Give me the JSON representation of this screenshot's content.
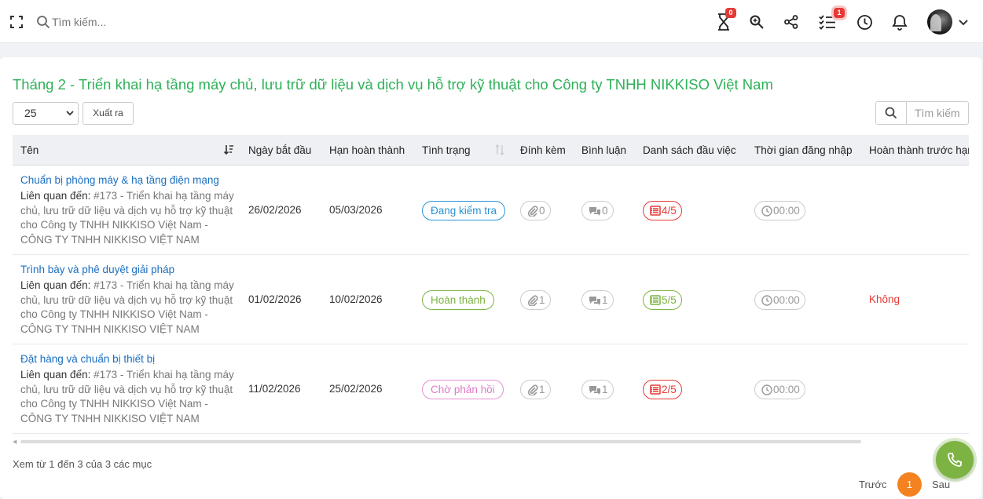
{
  "topbar": {
    "search_placeholder": "Tìm kiếm...",
    "hourglass_badge": "0",
    "checklist_badge": "1"
  },
  "page": {
    "title": "Tháng 2 - Triển khai hạ tầng máy chủ, lưu trữ dữ liệu và dịch vụ hỗ trợ kỹ thuật cho Công ty TNHH NIKKISO Việt Nam"
  },
  "controls": {
    "page_length": "25",
    "export_label": "Xuất ra",
    "table_search_placeholder": "Tìm kiếm"
  },
  "table": {
    "columns": [
      "Tên",
      "Ngày bắt đầu",
      "Hạn hoàn thành",
      "Tình trạng",
      "Đính kèm",
      "Bình luận",
      "Danh sách đầu việc",
      "Thời gian đăng nhập",
      "Hoàn thành trước hạn"
    ],
    "related_label": "Liên quan đến:",
    "rows": [
      {
        "name": "Chuẩn bị phòng máy & hạ tầng điện mạng",
        "related": "#173 - Triển khai hạ tầng máy chủ, lưu trữ dữ liệu và dịch vụ hỗ trợ kỹ thuật cho Công ty TNHH NIKKISO Việt Nam - CÔNG TY TNHH NIKKISO VIỆT NAM",
        "start": "26/02/2026",
        "due": "05/03/2026",
        "status": "Đang kiểm tra",
        "attachments": "0",
        "comments": "0",
        "checklist": "4/5",
        "time": "00:00",
        "early": ""
      },
      {
        "name": "Trình bày và phê duyệt giải pháp",
        "related": "#173 - Triển khai hạ tầng máy chủ, lưu trữ dữ liệu và dịch vụ hỗ trợ kỹ thuật cho Công ty TNHH NIKKISO Việt Nam - CÔNG TY TNHH NIKKISO VIỆT NAM",
        "start": "01/02/2026",
        "due": "10/02/2026",
        "status": "Hoàn thành",
        "attachments": "1",
        "comments": "1",
        "checklist": "5/5",
        "time": "00:00",
        "early": "Không"
      },
      {
        "name": "Đặt hàng và chuẩn bị thiết bị",
        "related": "#173 - Triển khai hạ tầng máy chủ, lưu trữ dữ liệu và dịch vụ hỗ trợ kỹ thuật cho Công ty TNHH NIKKISO Việt Nam - CÔNG TY TNHH NIKKISO VIỆT NAM",
        "start": "11/02/2026",
        "due": "25/02/2026",
        "status": "Chờ phản hồi",
        "attachments": "1",
        "comments": "1",
        "checklist": "2/5",
        "time": "00:00",
        "early": ""
      }
    ]
  },
  "footer": {
    "info": "Xem từ 1 đến 3 của 3 các mục",
    "prev_label": "Trước",
    "current_page": "1",
    "next_label": "Sau"
  },
  "colors": {
    "title_green": "#2eb158",
    "link_blue": "#1a6fc1",
    "status_review": "#2a93d5",
    "status_done": "#7cb342",
    "status_wait": "#e07ac8",
    "danger": "#e53935",
    "page_active": "#f58220"
  }
}
